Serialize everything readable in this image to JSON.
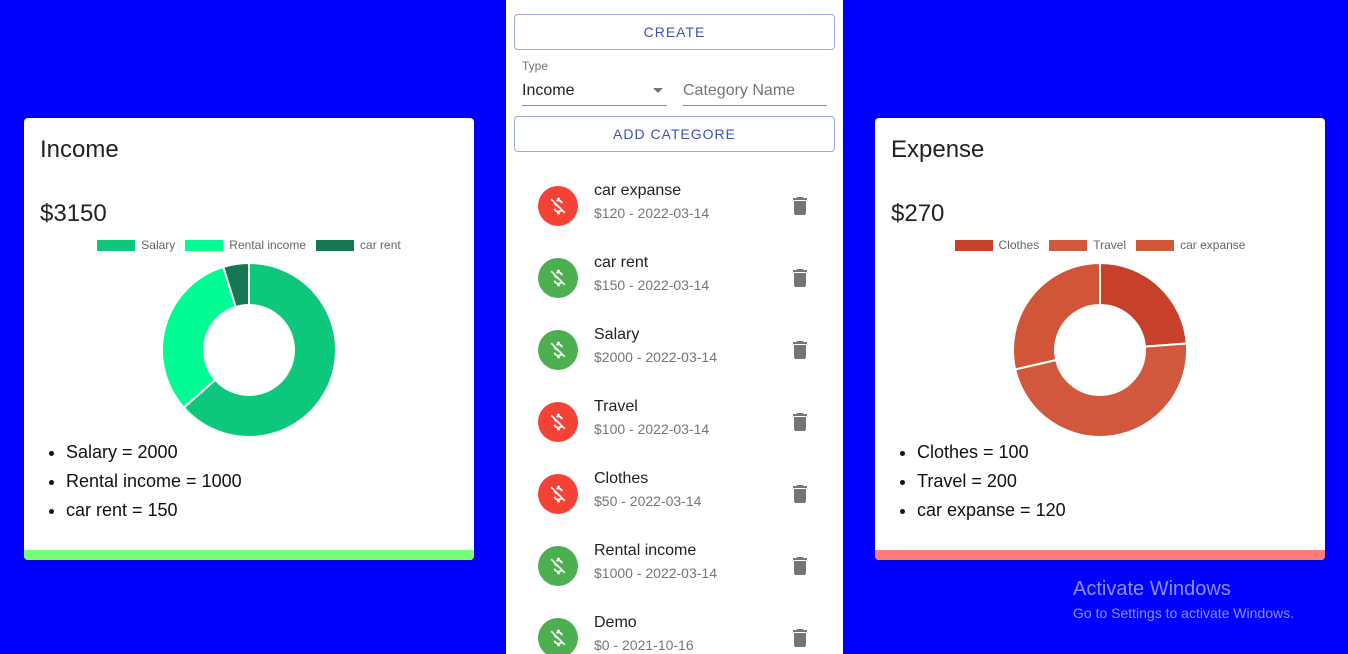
{
  "colors": {
    "page_bg": "#0000ff",
    "income_bar": "#76ff7a",
    "expense_bar": "#ff7a7a",
    "income_avatar": "#4caf50",
    "expense_avatar": "#f44336",
    "primary": "#3f51b5"
  },
  "income": {
    "title": "Income",
    "amount": "$3150",
    "list": [
      "Salary = 2000",
      "Rental income = 1000",
      "car rent = 150"
    ],
    "chart_data": {
      "type": "pie",
      "variant": "donut",
      "categories": [
        "Salary",
        "Rental income",
        "car rent"
      ],
      "values": [
        2000,
        1000,
        150
      ],
      "colors": [
        "#0dc77c",
        "#00fc92",
        "#167652"
      ],
      "legend": "top"
    }
  },
  "expense": {
    "title": "Expense",
    "amount": "$270",
    "list": [
      "Clothes = 100",
      "Travel = 200",
      "car expanse = 120"
    ],
    "chart_data": {
      "type": "pie",
      "variant": "donut",
      "categories": [
        "Clothes",
        "Travel",
        "car expanse"
      ],
      "values": [
        100,
        200,
        120
      ],
      "colors": [
        "#c6402a",
        "#d1583c",
        "#d05539"
      ],
      "legend": "top"
    }
  },
  "form": {
    "create_label": "CREATE",
    "type_label": "Type",
    "type_value": "Income",
    "category_placeholder": "Category Name",
    "add_category_label": "ADD CATEGORE"
  },
  "transactions": [
    {
      "name": "car expanse",
      "sub": "$120 - 2022-03-14",
      "kind": "expense",
      "icon": "money-off-icon"
    },
    {
      "name": "car rent",
      "sub": "$150 - 2022-03-14",
      "kind": "income",
      "icon": "money-off-icon"
    },
    {
      "name": "Salary",
      "sub": "$2000 - 2022-03-14",
      "kind": "income",
      "icon": "money-off-icon"
    },
    {
      "name": "Travel",
      "sub": "$100 - 2022-03-14",
      "kind": "expense",
      "icon": "money-off-icon"
    },
    {
      "name": "Clothes",
      "sub": "$50 - 2022-03-14",
      "kind": "expense",
      "icon": "money-off-icon"
    },
    {
      "name": "Rental income",
      "sub": "$1000 - 2022-03-14",
      "kind": "income",
      "icon": "money-off-icon"
    },
    {
      "name": "Demo",
      "sub": "$0 - 2021-10-16",
      "kind": "income",
      "icon": "money-off-icon"
    }
  ],
  "watermark": {
    "title": "Activate Windows",
    "subtitle": "Go to Settings to activate Windows."
  }
}
